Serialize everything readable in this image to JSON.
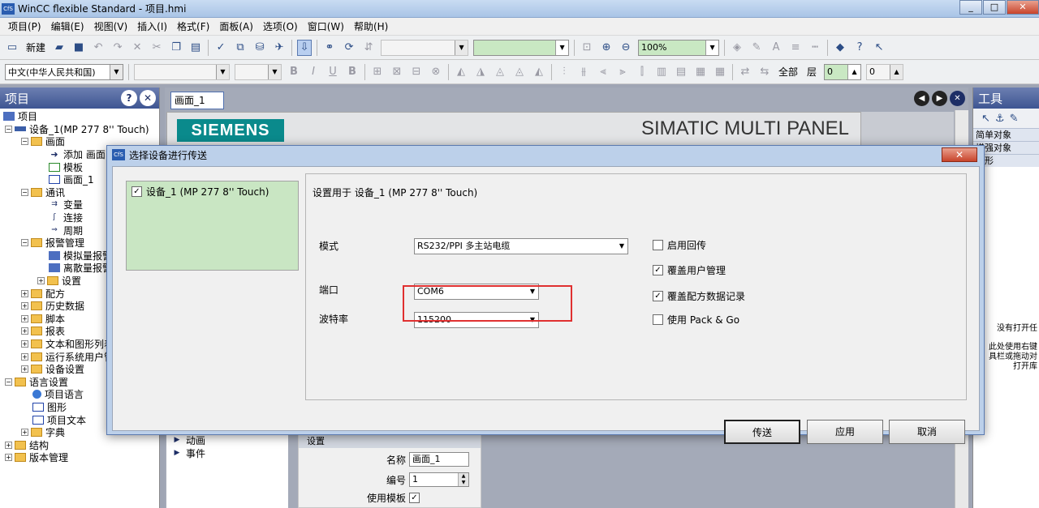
{
  "window": {
    "title": "WinCC flexible Standard - 项目.hmi",
    "app_icon": "CfS"
  },
  "menu": [
    "项目(P)",
    "编辑(E)",
    "视图(V)",
    "插入(I)",
    "格式(F)",
    "面板(A)",
    "选项(O)",
    "窗口(W)",
    "帮助(H)"
  ],
  "toolbar1": {
    "new_label": "新建",
    "zoom_value": "100%"
  },
  "toolbar2": {
    "language_value": "中文(中华人民共和国)",
    "all_label": "全部",
    "layer_label": "层",
    "layer_value": "0",
    "layer_value2": "0"
  },
  "project_panel": {
    "title": "项目",
    "tree": [
      {
        "label": "项目",
        "level": 0,
        "icon": "project-icon"
      },
      {
        "label": "设备_1(MP 277 8'' Touch)",
        "level": 1,
        "icon": "device-icon"
      },
      {
        "label": "画面",
        "level": 2,
        "icon": "folder-icon"
      },
      {
        "label": "添加 画面",
        "level": 3,
        "icon": "add-screen-icon"
      },
      {
        "label": "模板",
        "level": 3,
        "icon": "template-icon"
      },
      {
        "label": "画面_1",
        "level": 3,
        "icon": "screen-icon"
      },
      {
        "label": "通讯",
        "level": 2,
        "icon": "folder-icon"
      },
      {
        "label": "变量",
        "level": 3,
        "icon": "tags-icon"
      },
      {
        "label": "连接",
        "level": 3,
        "icon": "connection-icon"
      },
      {
        "label": "周期",
        "level": 3,
        "icon": "cycle-icon"
      },
      {
        "label": "报警管理",
        "level": 2,
        "icon": "folder-icon"
      },
      {
        "label": "模拟量报警",
        "level": 3,
        "icon": "alarm-icon"
      },
      {
        "label": "离散量报警",
        "level": 3,
        "icon": "alarm-icon"
      },
      {
        "label": "设置",
        "level": 3,
        "icon": "folder-icon"
      },
      {
        "label": "配方",
        "level": 2,
        "icon": "folder-icon"
      },
      {
        "label": "历史数据",
        "level": 2,
        "icon": "folder-icon"
      },
      {
        "label": "脚本",
        "level": 2,
        "icon": "folder-icon"
      },
      {
        "label": "报表",
        "level": 2,
        "icon": "folder-icon"
      },
      {
        "label": "文本和图形列表",
        "level": 2,
        "icon": "folder-icon"
      },
      {
        "label": "运行系统用户管理",
        "level": 2,
        "icon": "folder-icon"
      },
      {
        "label": "设备设置",
        "level": 2,
        "icon": "folder-icon"
      },
      {
        "label": "语言设置",
        "level": 1,
        "icon": "folder-icon"
      },
      {
        "label": "项目语言",
        "level": 2,
        "icon": "globe-icon"
      },
      {
        "label": "图形",
        "level": 2,
        "icon": "graphic-icon"
      },
      {
        "label": "项目文本",
        "level": 2,
        "icon": "text-icon"
      },
      {
        "label": "字典",
        "level": 2,
        "icon": "folder-icon"
      },
      {
        "label": "结构",
        "level": 0,
        "icon": "folder-icon"
      },
      {
        "label": "版本管理",
        "level": 0,
        "icon": "folder-icon"
      }
    ]
  },
  "editor": {
    "tab_label": "画面_1",
    "brand": "SIEMENS",
    "panel_name": "SIMATIC MULTI PANEL",
    "lower_tree": [
      "动画",
      "事件"
    ],
    "properties": {
      "group": "设置",
      "name_label": "名称",
      "name_value": "画面_1",
      "number_label": "编号",
      "number_value": "1",
      "template_label": "使用模板"
    }
  },
  "tools_panel": {
    "title": "工具",
    "categories": [
      "简单对象",
      "增强对象",
      "图形"
    ],
    "note_lines": [
      "没有打开任",
      "此处使用右键",
      "具栏或拖动对",
      "打开库"
    ]
  },
  "dialog": {
    "title": "选择设备进行传送",
    "device_item": "设备_1 (MP 277 8'' Touch)",
    "settings_header": "设置用于 设备_1 (MP 277 8'' Touch)",
    "mode_label": "模式",
    "mode_value": "RS232/PPI 多主站电缆",
    "port_label": "端口",
    "port_value": "COM6",
    "baud_label": "波特率",
    "baud_value": "115200",
    "options": [
      {
        "label": "启用回传",
        "checked": false
      },
      {
        "label": "覆盖用户管理",
        "checked": true
      },
      {
        "label": "覆盖配方数据记录",
        "checked": true
      },
      {
        "label": "使用 Pack & Go",
        "checked": false
      }
    ],
    "buttons": {
      "transfer": "传送",
      "apply": "应用",
      "cancel": "取消"
    }
  },
  "colors": {
    "highlight_box": "#e03030",
    "panel_header": "#3e5592",
    "device_list_bg": "#c9e6c3",
    "siemens_teal": "#0a8a8c"
  }
}
